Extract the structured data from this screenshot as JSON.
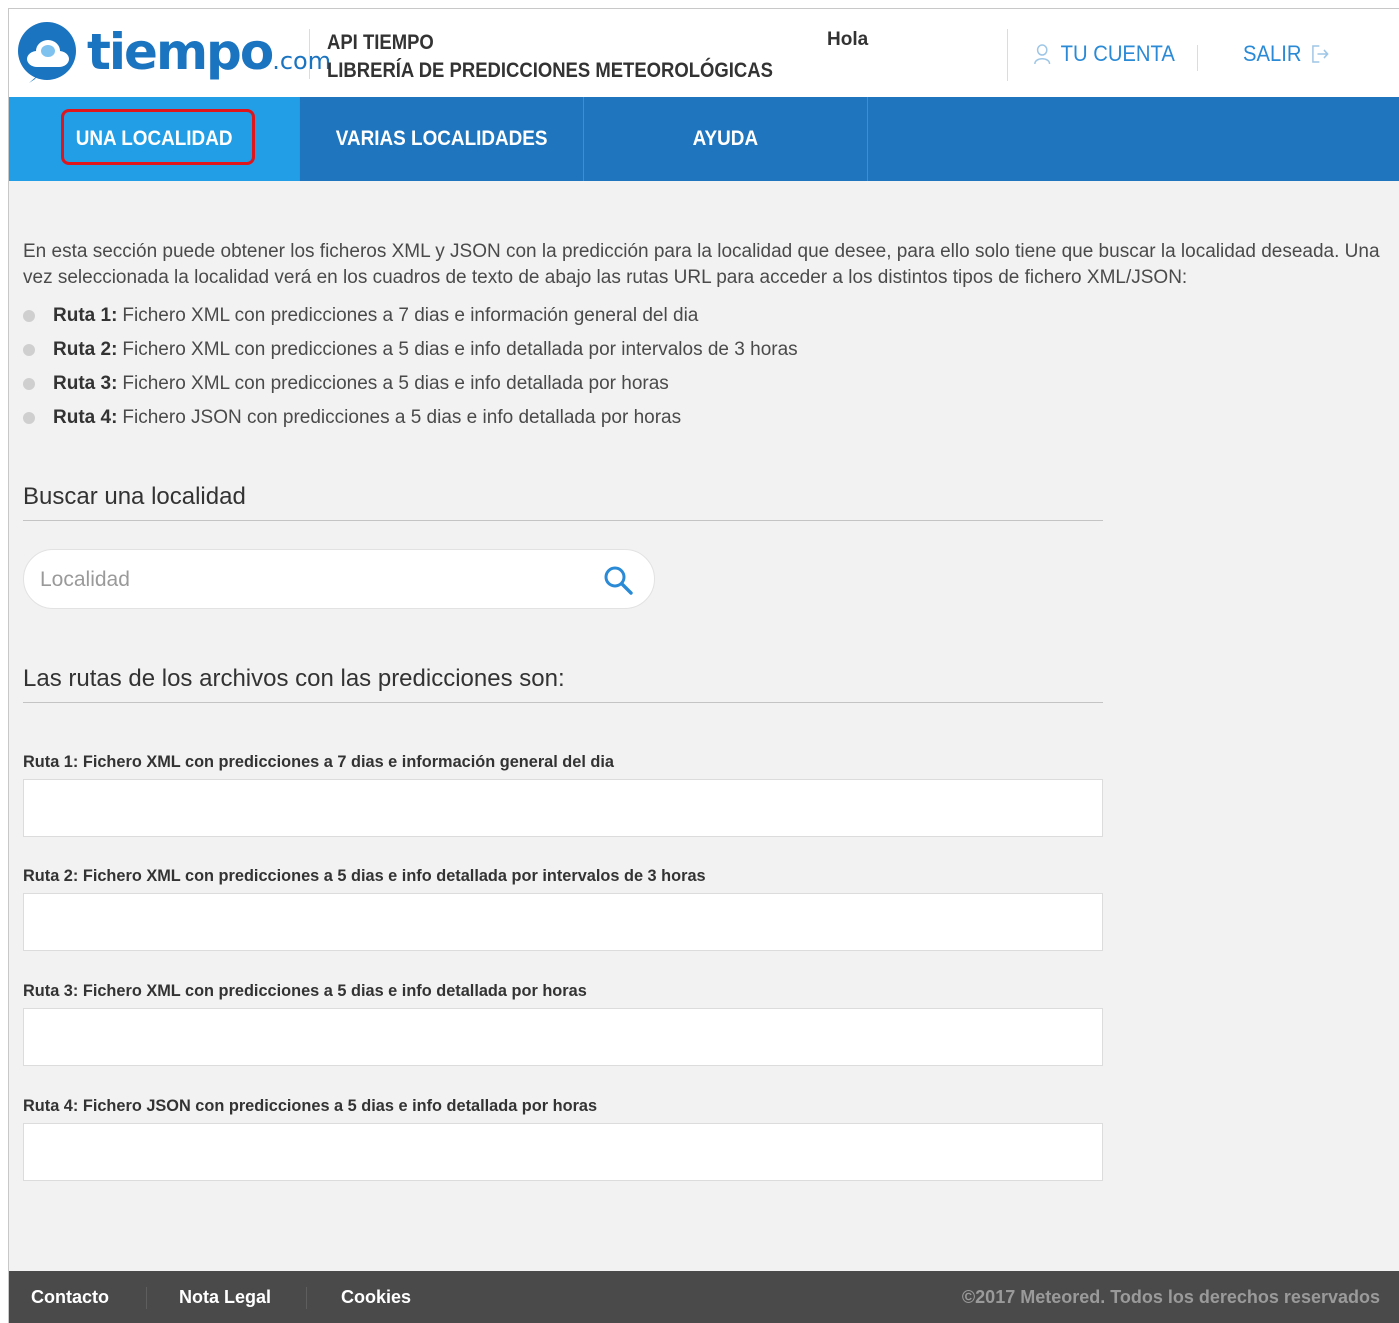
{
  "brand": {
    "name": "tiempo",
    "suffix": ".com"
  },
  "header": {
    "api_line1": "API TIEMPO",
    "api_line2": "LIBRERÍA DE PREDICCIONES METEOROLÓGICAS",
    "greeting": "Hola",
    "account_label": "TU CUENTA",
    "logout_label": "SALIR"
  },
  "nav": {
    "tabs": [
      {
        "label": "UNA LOCALIDAD",
        "active": true
      },
      {
        "label": "VARIAS LOCALIDADES",
        "active": false
      },
      {
        "label": "AYUDA",
        "active": false
      }
    ]
  },
  "intro": {
    "text": "En esta sección puede obtener los ficheros XML y JSON con la predicción para la localidad que desee, para ello solo tiene que buscar la localidad deseada. Una vez seleccionada la localidad verá en los cuadros de texto de abajo las rutas URL para acceder a los distintos tipos de fichero XML/JSON:",
    "bullets": [
      {
        "key": "Ruta 1:",
        "desc": "Fichero XML con predicciones a 7 dias e información general del dia"
      },
      {
        "key": "Ruta 2:",
        "desc": "Fichero XML con predicciones a 5 dias e info detallada por intervalos de 3 horas"
      },
      {
        "key": "Ruta 3:",
        "desc": "Fichero XML con predicciones a 5 dias e info detallada por horas"
      },
      {
        "key": "Ruta 4:",
        "desc": "Fichero JSON con predicciones a 5 dias e info detallada por horas"
      }
    ]
  },
  "search": {
    "title": "Buscar una localidad",
    "placeholder": "Localidad",
    "value": ""
  },
  "routes": {
    "title": "Las rutas de los archivos con las predicciones son:",
    "items": [
      {
        "label": "Ruta 1: Fichero XML con predicciones a 7 dias e información general del dia",
        "value": ""
      },
      {
        "label": "Ruta 2: Fichero XML con predicciones a 5 dias e info detallada por intervalos de 3 horas",
        "value": ""
      },
      {
        "label": "Ruta 3: Fichero XML con predicciones a 5 dias e info detallada por horas",
        "value": ""
      },
      {
        "label": "Ruta 4: Fichero JSON con predicciones a 5 dias e info detallada por horas",
        "value": ""
      }
    ]
  },
  "footer": {
    "links": [
      "Contacto",
      "Nota Legal",
      "Cookies"
    ],
    "copyright": "©2017 Meteored. Todos los derechos reservados"
  },
  "colors": {
    "nav_blue": "#1f76bf",
    "active_tab": "#219ee6",
    "brand_blue": "#1b74c0",
    "link_blue": "#2a8ad6",
    "highlight_red": "#e0141b",
    "footer_bg": "#4a4a4a"
  },
  "icons": [
    "cloud-logo-icon",
    "user-icon",
    "logout-icon",
    "search-icon"
  ]
}
